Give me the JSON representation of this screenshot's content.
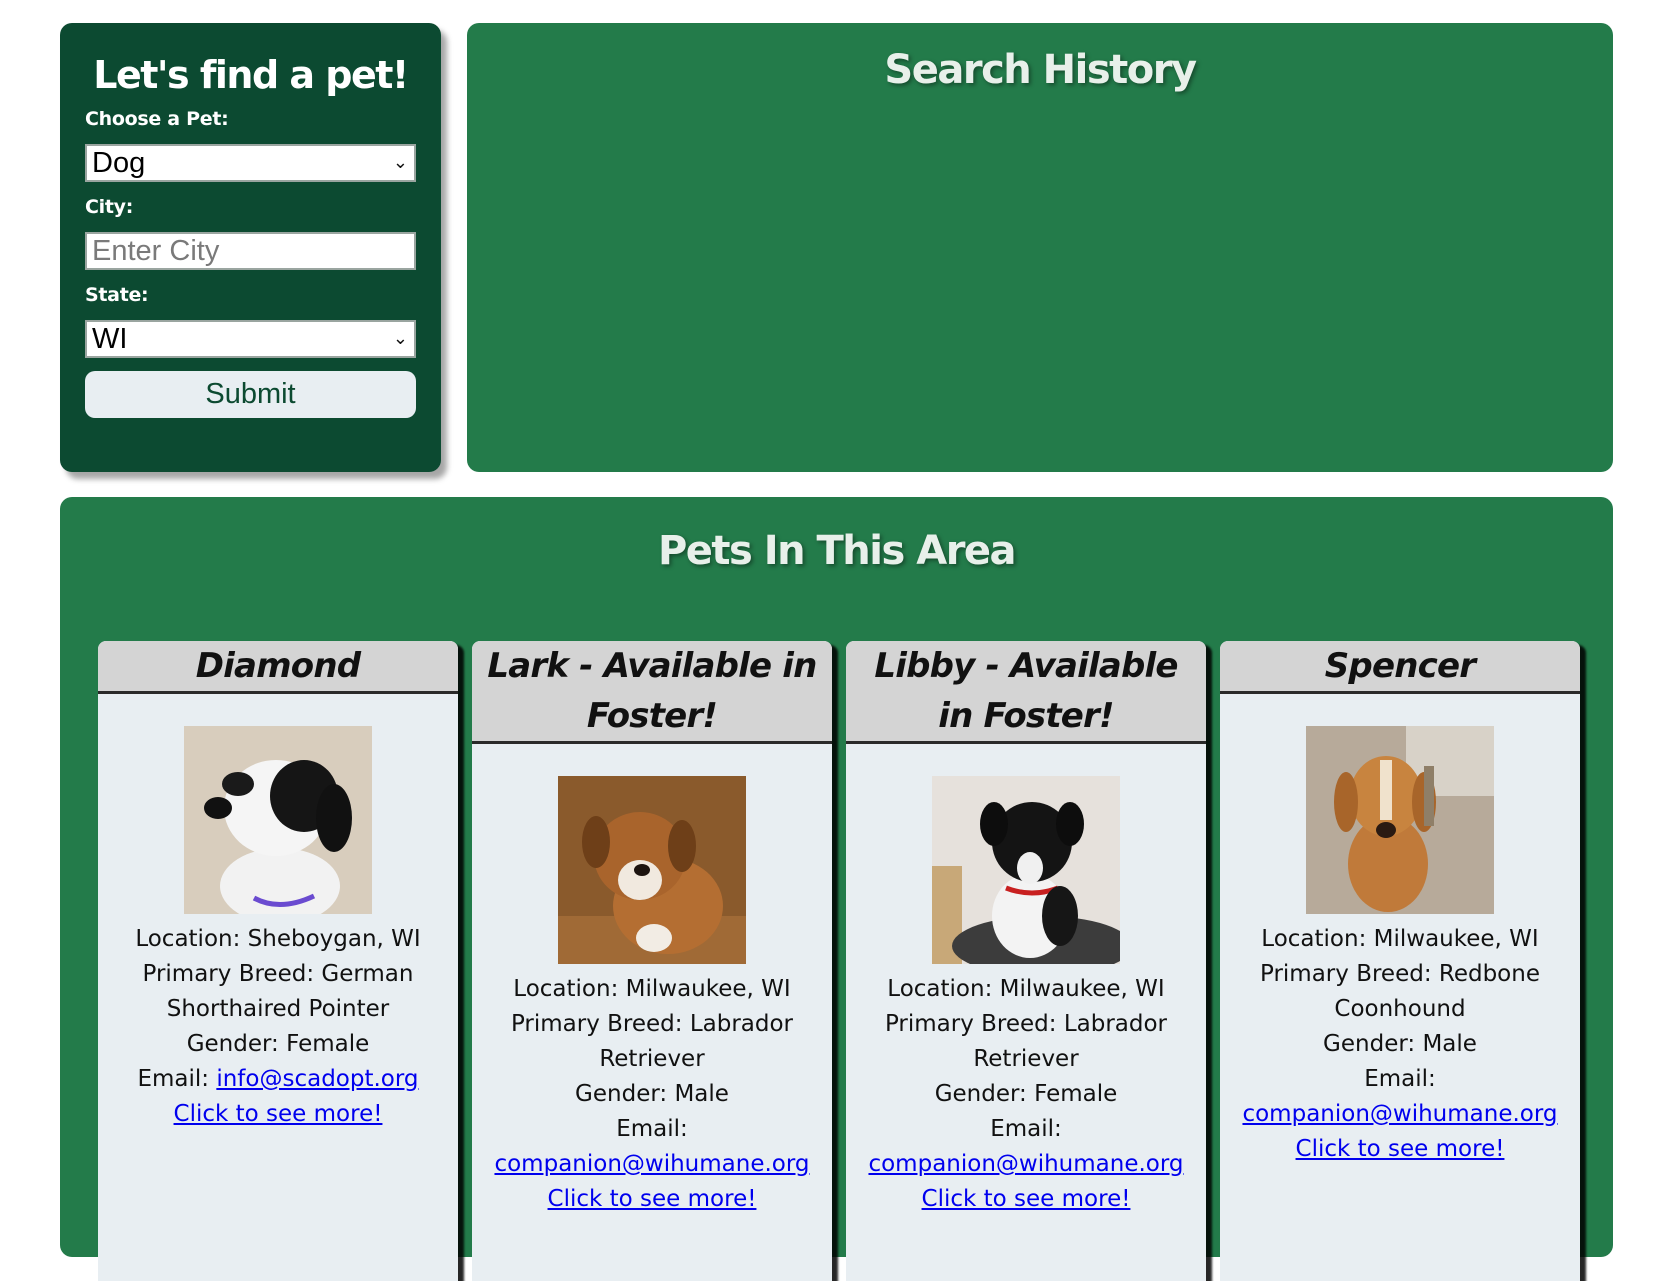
{
  "search_form": {
    "title": "Let's find a pet!",
    "pet_label": "Choose a Pet:",
    "pet_value": "Dog",
    "city_label": "City:",
    "city_placeholder": "Enter City",
    "state_label": "State:",
    "state_value": "WI",
    "submit_label": "Submit"
  },
  "history": {
    "title": "Search History"
  },
  "pets_section": {
    "title": "Pets In This Area",
    "cards": [
      {
        "name": "Diamond",
        "photo": "dog-photo-black-white",
        "location": "Location: Sheboygan, WI",
        "breed": "Primary Breed: German Shorthaired Pointer",
        "gender": "Gender: Female",
        "email_label": "Email:",
        "email": "info@scadopt.org",
        "more_link": "Click to see more!"
      },
      {
        "name": "Lark - Available in Foster!",
        "photo": "dog-photo-brown-puppy",
        "location": "Location: Milwaukee, WI",
        "breed": "Primary Breed: Labrador Retriever",
        "gender": "Gender: Male",
        "email_label": "Email:",
        "email": "companion@wihumane.org",
        "more_link": "Click to see more!"
      },
      {
        "name": "Libby - Available in Foster!",
        "photo": "dog-photo-black-puppy",
        "location": "Location: Milwaukee, WI",
        "breed": "Primary Breed: Labrador Retriever",
        "gender": "Gender: Female",
        "email_label": "Email:",
        "email": "companion@wihumane.org",
        "more_link": "Click to see more!"
      },
      {
        "name": "Spencer",
        "photo": "dog-photo-redbone-hound",
        "location": "Location: Milwaukee, WI",
        "breed": "Primary Breed: Redbone Coonhound",
        "gender": "Gender: Male",
        "email_label": "Email:",
        "email": "companion@wihumane.org",
        "more_link": "Click to see more!"
      }
    ]
  },
  "colors": {
    "form_bg": "#0c4a31",
    "panel_bg": "#237b4a",
    "card_bg": "#e8eef2",
    "card_header_bg": "#d4d4d4",
    "link": "#0000ee"
  }
}
